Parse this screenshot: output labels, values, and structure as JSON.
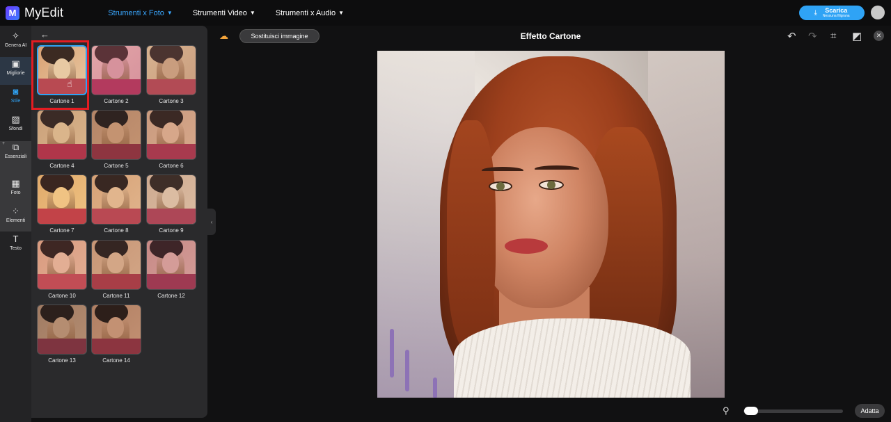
{
  "app": {
    "logo_letter": "M",
    "name": "MyEdit"
  },
  "nav": {
    "items": [
      {
        "label": "Strumenti x Foto",
        "active": true
      },
      {
        "label": "Strumenti Video",
        "active": false
      },
      {
        "label": "Strumenti x Audio",
        "active": false
      }
    ],
    "download": {
      "label": "Scarica",
      "sublabel": "Nessuna filigrana"
    }
  },
  "rail": {
    "items": [
      {
        "label": "Genera AI",
        "icon": "magic-wand-icon",
        "glyph": "✧"
      },
      {
        "label": "Migliorie",
        "icon": "enhance-image-icon",
        "glyph": "▣"
      },
      {
        "label": "Stile",
        "icon": "style-portrait-icon",
        "glyph": "◙",
        "active": true
      },
      {
        "label": "Sfondi",
        "icon": "background-icon",
        "glyph": "▨"
      },
      {
        "label": "Essenziali",
        "icon": "crop-layers-icon",
        "glyph": "⧉"
      },
      {
        "label": "Foto",
        "icon": "photo-icon",
        "glyph": "▦"
      },
      {
        "label": "Elementi",
        "icon": "shapes-icon",
        "glyph": "⁘"
      },
      {
        "label": "Testo",
        "icon": "text-icon",
        "glyph": "T"
      }
    ]
  },
  "panel": {
    "styles": [
      "Cartone 1",
      "Cartone 2",
      "Cartone 3",
      "Cartone 4",
      "Cartone 5",
      "Cartone 6",
      "Cartone 7",
      "Cartone 8",
      "Cartone 9",
      "Cartone 10",
      "Cartone 11",
      "Cartone 12",
      "Cartone 13",
      "Cartone 14"
    ],
    "selected": "Cartone 1"
  },
  "canvas": {
    "replace_label": "Sostituisci immagine",
    "title": "Effetto Cartone",
    "fit_label": "Adatta",
    "zoom_level": 0
  },
  "colors": {
    "accent": "#2fa3f5",
    "highlight": "#e41d22"
  }
}
